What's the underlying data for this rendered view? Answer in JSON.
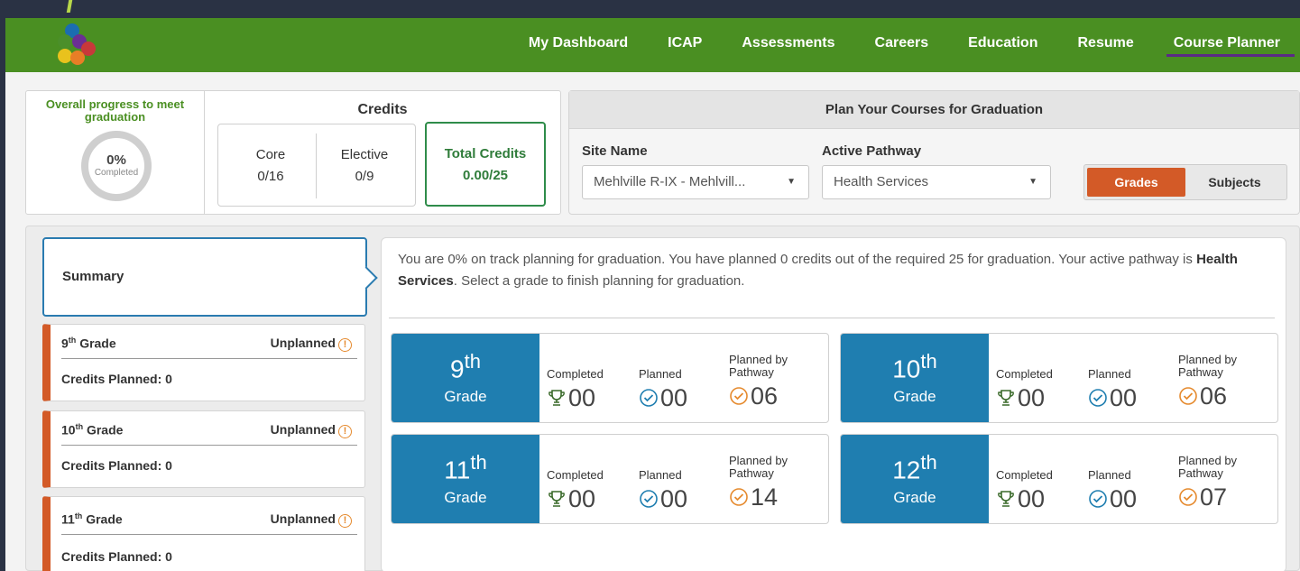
{
  "nav": {
    "items": [
      {
        "label": "My Dashboard"
      },
      {
        "label": "ICAP"
      },
      {
        "label": "Assessments"
      },
      {
        "label": "Careers"
      },
      {
        "label": "Education"
      },
      {
        "label": "Resume"
      },
      {
        "label": "Course Planner"
      }
    ],
    "active": "Course Planner"
  },
  "progress": {
    "title": "Overall progress to meet graduation",
    "percent": "0%",
    "percent_label": "Completed",
    "credits_title": "Credits",
    "core_label": "Core",
    "core_value": "0/16",
    "elective_label": "Elective",
    "elective_value": "0/9",
    "total_label": "Total Credits",
    "total_value": "0.00/25"
  },
  "plan": {
    "title": "Plan Your Courses for Graduation",
    "site_label": "Site Name",
    "site_value": "Mehlville R-IX - Mehlvill...",
    "pathway_label": "Active Pathway",
    "pathway_value": "Health Services",
    "toggle_grades": "Grades",
    "toggle_subjects": "Subjects"
  },
  "sidebar": {
    "summary_label": "Summary",
    "grades": [
      {
        "num": "9",
        "suffix": "th",
        "word": "Grade",
        "status": "Unplanned",
        "credits": "Credits Planned: 0"
      },
      {
        "num": "10",
        "suffix": "th",
        "word": "Grade",
        "status": "Unplanned",
        "credits": "Credits Planned: 0"
      },
      {
        "num": "11",
        "suffix": "th",
        "word": "Grade",
        "status": "Unplanned",
        "credits": "Credits Planned: 0"
      }
    ]
  },
  "summary": {
    "text_pre": "You are 0% on track planning for graduation. You have planned 0 credits out of the required 25 for graduation. Your active pathway is ",
    "pathway_bold": "Health Services",
    "text_post": ". Select a grade to finish planning for graduation."
  },
  "grade_cards": [
    {
      "num": "9",
      "suffix": "th",
      "word": "Grade",
      "completed_label": "Completed",
      "completed": "00",
      "planned_label": "Planned",
      "planned": "00",
      "pathway_label": "Planned by Pathway",
      "pathway": "06"
    },
    {
      "num": "10",
      "suffix": "th",
      "word": "Grade",
      "completed_label": "Completed",
      "completed": "00",
      "planned_label": "Planned",
      "planned": "00",
      "pathway_label": "Planned by Pathway",
      "pathway": "06"
    },
    {
      "num": "11",
      "suffix": "th",
      "word": "Grade",
      "completed_label": "Completed",
      "completed": "00",
      "planned_label": "Planned",
      "planned": "00",
      "pathway_label": "Planned by Pathway",
      "pathway": "14"
    },
    {
      "num": "12",
      "suffix": "th",
      "word": "Grade",
      "completed_label": "Completed",
      "completed": "00",
      "planned_label": "Planned",
      "planned": "00",
      "pathway_label": "Planned by Pathway",
      "pathway": "07"
    }
  ],
  "colors": {
    "nav_green": "#4a8f22",
    "accent_orange": "#d35a27",
    "grade_blue": "#1f7eb0",
    "total_green": "#2f8c4a"
  }
}
